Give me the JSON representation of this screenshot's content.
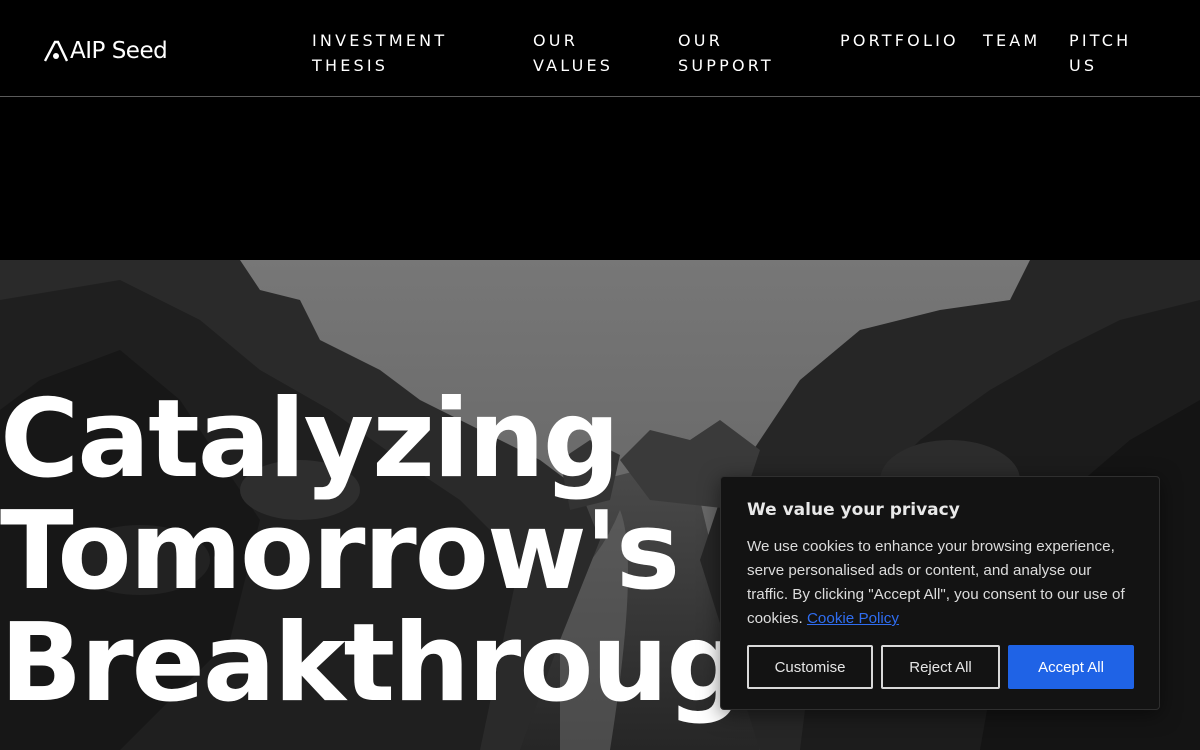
{
  "brand": {
    "name": "AIP Seed",
    "logo_icon": "triangle-a-mark"
  },
  "nav": [
    {
      "label": "INVESTMENT\nTHESIS"
    },
    {
      "label": "OUR\nVALUES"
    },
    {
      "label": "OUR\nSUPPORT"
    },
    {
      "label": "PORTFOLIO"
    },
    {
      "label": "TEAM"
    },
    {
      "label": "PITCH\nUS"
    }
  ],
  "hero": {
    "title_lines": [
      "Catalyzing",
      "Tomorrow's",
      "Breakthroughs"
    ],
    "background_icon": "canyon-photo"
  },
  "cookie_banner": {
    "title": "We value your privacy",
    "body": "We use cookies to enhance your browsing experience, serve personalised ads or content, and analyse our traffic. By clicking \"Accept All\", you consent to our use of cookies.",
    "link_label": "Cookie Policy",
    "customise_label": "Customise",
    "reject_label": "Reject All",
    "accept_label": "Accept All",
    "accent_color": "#1f63e6"
  }
}
